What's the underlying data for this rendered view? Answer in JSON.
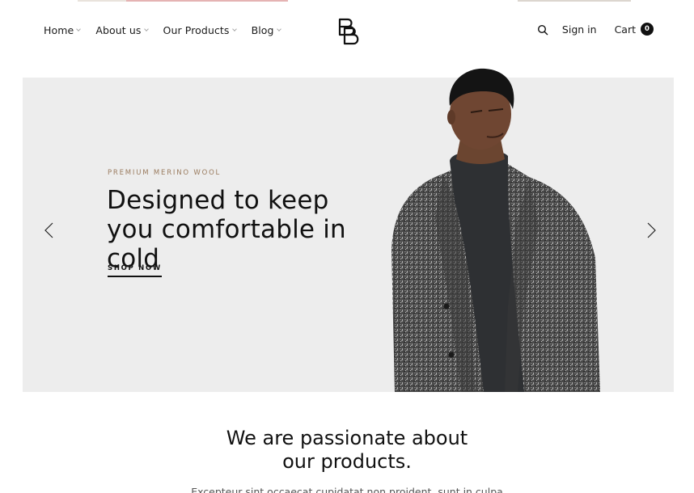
{
  "header": {
    "nav": [
      {
        "label": "Home"
      },
      {
        "label": "About us"
      },
      {
        "label": "Our Products"
      },
      {
        "label": "Blog"
      }
    ],
    "signin_label": "Sign in",
    "cart_label": "Cart",
    "cart_count": "0"
  },
  "hero": {
    "eyebrow": "PREMIUM MERINO WOOL",
    "headline": "Designed to keep you comfortable in cold",
    "cta_label": "SHOP NOW",
    "background_color": "#ededed"
  },
  "intro": {
    "title_line1": "We are passionate about",
    "title_line2": "our products.",
    "body": "Excepteur sint occaecat cupidatat non proident, sunt in culpa"
  },
  "colors": {
    "accent": "#9a7b5e",
    "text": "#111111",
    "badge": "#111111"
  },
  "icons": [
    "logo-b-icon",
    "search-icon",
    "chevron-left-icon",
    "chevron-right-icon",
    "chevron-down-icon"
  ]
}
